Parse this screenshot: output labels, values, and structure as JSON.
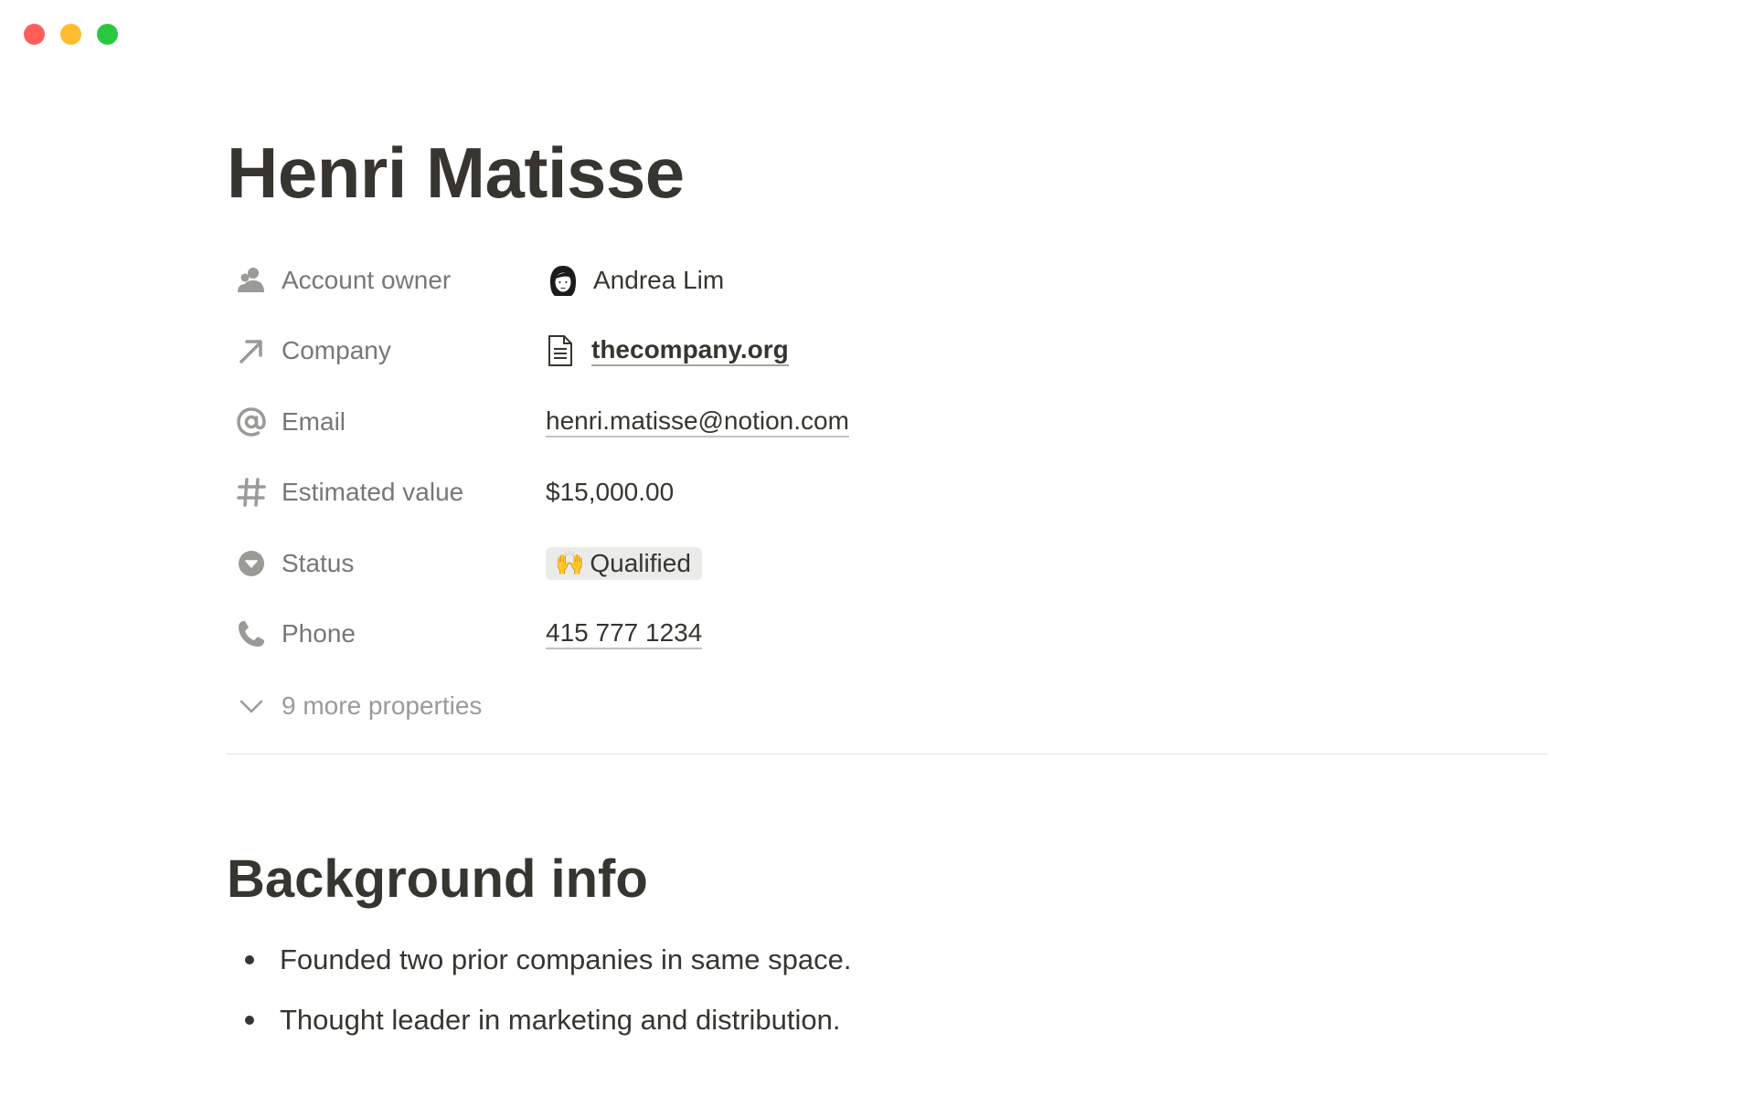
{
  "window": {
    "controls": [
      "close",
      "minimize",
      "zoom"
    ]
  },
  "page": {
    "title": "Henri Matisse"
  },
  "properties": [
    {
      "icon": "person-icon",
      "name": "Account owner",
      "value": "Andrea Lim",
      "kind": "person"
    },
    {
      "icon": "relation-arrow-icon",
      "name": "Company",
      "value": "thecompany.org",
      "kind": "relation"
    },
    {
      "icon": "at-sign-icon",
      "name": "Email",
      "value": "henri.matisse@notion.com",
      "kind": "email"
    },
    {
      "icon": "hash-icon",
      "name": "Estimated value",
      "value": "$15,000.00",
      "kind": "number"
    },
    {
      "icon": "status-icon",
      "name": "Status",
      "value": "Qualified",
      "emoji": "🙌",
      "kind": "status"
    },
    {
      "icon": "phone-icon",
      "name": "Phone",
      "value": "415 777 1234",
      "kind": "phone"
    }
  ],
  "more_properties": {
    "icon": "chevron-down-icon",
    "label": "9 more properties"
  },
  "section": {
    "heading": "Background info",
    "bullets": [
      "Founded two prior companies in same space.",
      "Thought leader in marketing and distribution."
    ]
  },
  "colors": {
    "text": "#37352f",
    "muted": "#787774",
    "status_bg": "#ebebea",
    "divider": "#e3e2e0"
  }
}
